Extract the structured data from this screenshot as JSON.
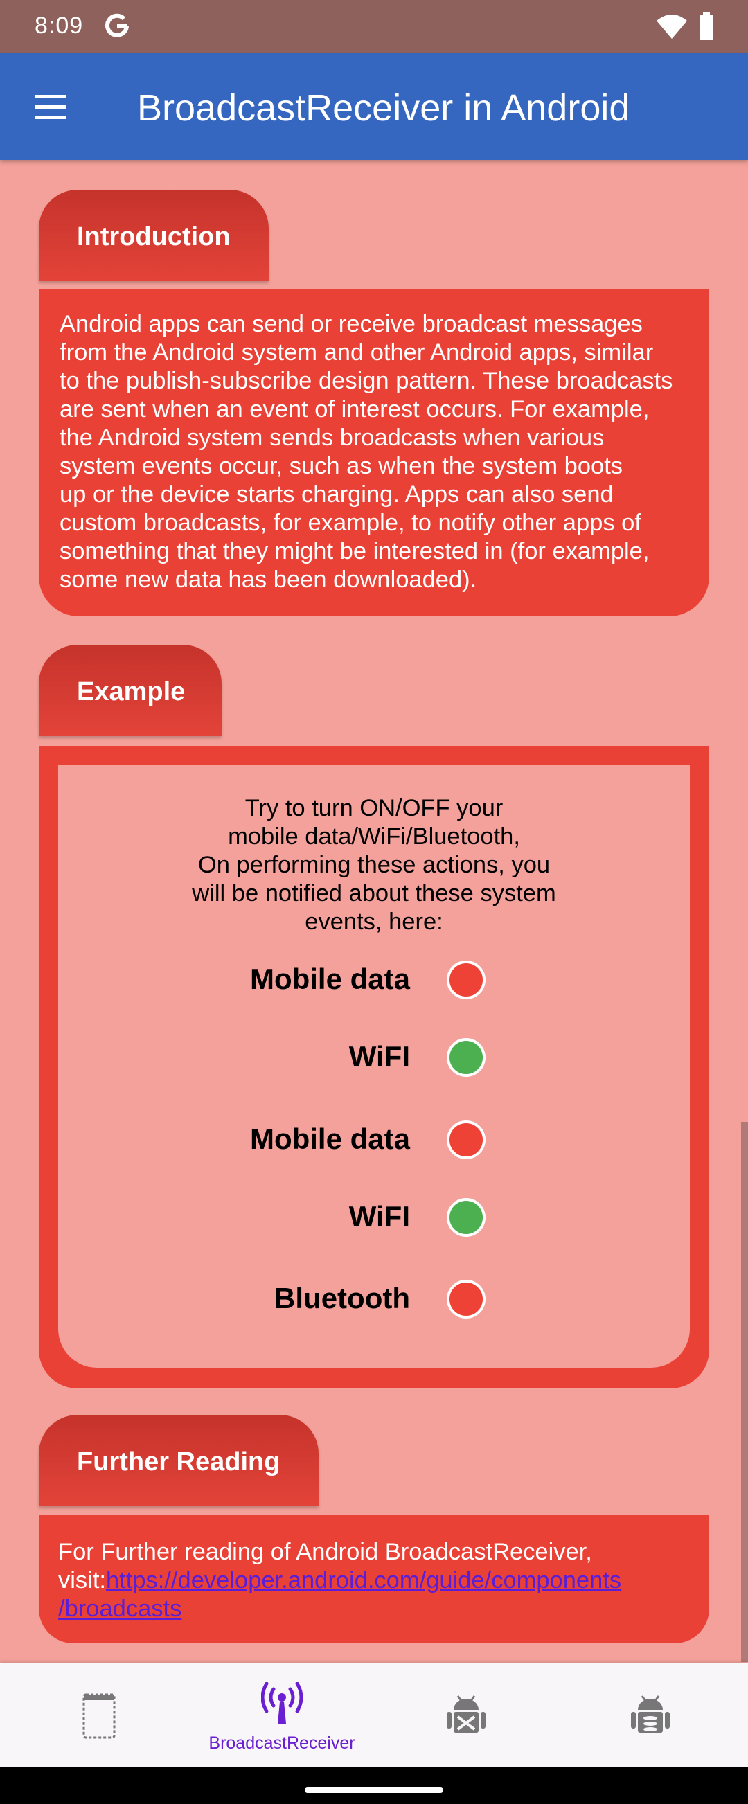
{
  "status_bar": {
    "time": "8:09",
    "icons": [
      "google-icon",
      "wifi-icon",
      "battery-icon"
    ]
  },
  "app_bar": {
    "title": "BroadcastReceiver in Android",
    "menu_icon": "hamburger-menu-icon"
  },
  "introduction": {
    "heading": "Introduction",
    "lines": [
      "Android apps can send or receive broadcast messages",
      "from the Android system and other Android apps, similar",
      "to the publish-subscribe design pattern. These broadcasts",
      "are sent when an event of interest occurs. For example,",
      "the Android system sends broadcasts when various",
      "system events occur, such as when the system boots",
      "up or the device starts charging. Apps can also send",
      "custom broadcasts, for example, to notify other apps of",
      "something that they might be interested in (for example,",
      "some new data has been downloaded)."
    ]
  },
  "example": {
    "heading": "Example",
    "instruction_lines": [
      "Try to turn ON/OFF your",
      "mobile data/WiFi/Bluetooth,",
      "On performing these actions, you",
      "will be notified about these system",
      "events, here:"
    ],
    "statuses": [
      {
        "label": "Mobile data",
        "state": "off",
        "color": "#ee4237"
      },
      {
        "label": "WiFI",
        "state": "on",
        "color": "#4caf50"
      },
      {
        "label": "Mobile data",
        "state": "off",
        "color": "#ee4237"
      },
      {
        "label": "WiFI",
        "state": "on",
        "color": "#4caf50"
      },
      {
        "label": "Bluetooth",
        "state": "off",
        "color": "#ee4237"
      }
    ]
  },
  "further_reading": {
    "heading": "Further Reading",
    "text": "For Further reading of Android BroadcastReceiver,",
    "visit_prefix": "visit:",
    "link_line1": "https://developer.android.com/guide/components",
    "link_line2": "/broadcasts"
  },
  "bottom_nav": {
    "items": [
      {
        "icon": "activity-screen-icon",
        "label": ""
      },
      {
        "icon": "broadcast-antenna-icon",
        "label": "BroadcastReceiver",
        "active": true
      },
      {
        "icon": "android-service-icon",
        "label": ""
      },
      {
        "icon": "android-provider-icon",
        "label": ""
      }
    ]
  },
  "colors": {
    "background": "#f3a19a",
    "panel": "#ea4137",
    "app_bar": "#3567c0",
    "status_bar": "#8f615c",
    "active_nav": "#6a1fd0"
  }
}
